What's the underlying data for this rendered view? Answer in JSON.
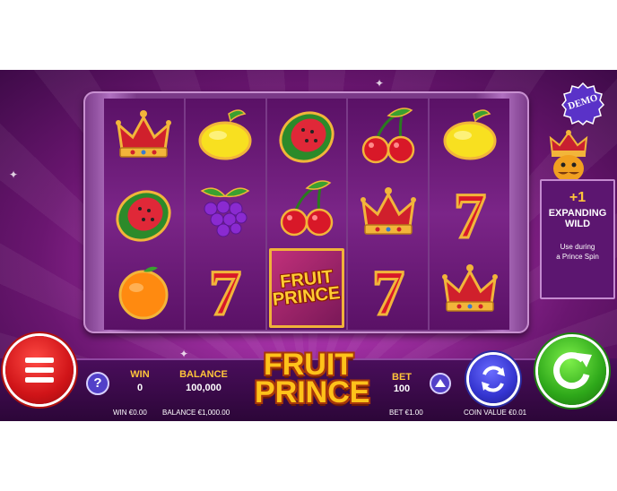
{
  "badge": {
    "demo": "DEMO"
  },
  "bonus": {
    "count": "+1",
    "title_line1": "EXPANDING",
    "title_line2": "WILD",
    "desc_line1": "Use during",
    "desc_line2": "a Prince Spin"
  },
  "reels": [
    [
      "crown",
      "watermelon",
      "orange"
    ],
    [
      "lemon",
      "grapes",
      "seven"
    ],
    [
      "watermelon",
      "cherries",
      "fruit-prince"
    ],
    [
      "cherries",
      "crown",
      "seven"
    ],
    [
      "lemon",
      "seven",
      "crown"
    ]
  ],
  "scatter": {
    "line1": "FRUIT",
    "line2": "PRINCE"
  },
  "hud": {
    "help": "?",
    "win_label": "WIN",
    "win_value": "0",
    "balance_label": "BALANCE",
    "balance_value": "100,000",
    "bet_label": "BET",
    "bet_value": "100"
  },
  "logo": {
    "line1": "FRUIT",
    "line2": "PRINCE"
  },
  "footer": {
    "win": "WIN €0.00",
    "balance": "BALANCE €1,000.00",
    "bet": "BET €1.00",
    "coin_value": "COIN VALUE €0.01"
  },
  "colors": {
    "accent": "#ffc53a",
    "menu": "#d01418",
    "spin": "#2ea81a",
    "autoplay": "#3434d0"
  },
  "icons": [
    "menu-icon",
    "help-icon",
    "arrow-up-icon",
    "autoplay-icon",
    "spin-icon"
  ]
}
